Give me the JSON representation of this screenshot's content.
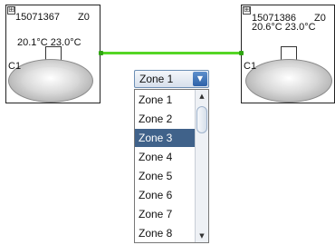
{
  "nodes": [
    {
      "expand": "⊞",
      "id": "15071367",
      "zone": "Z0",
      "temps": "20.1°C  23.0°C",
      "channel": "C1"
    },
    {
      "expand": "⊞",
      "id": "15071386",
      "zone": "Z0",
      "temps": "20.6°C  23.0°C",
      "channel": "C1"
    }
  ],
  "link": {
    "color": "#55d625"
  },
  "zone_select": {
    "value": "Zone 1",
    "arrow": "▼",
    "options": [
      "Zone 1",
      "Zone 2",
      "Zone 3",
      "Zone 4",
      "Zone 5",
      "Zone 6",
      "Zone 7",
      "Zone 8"
    ],
    "highlighted": "Zone 3",
    "scroll_up": "▲",
    "scroll_down": "▼"
  }
}
